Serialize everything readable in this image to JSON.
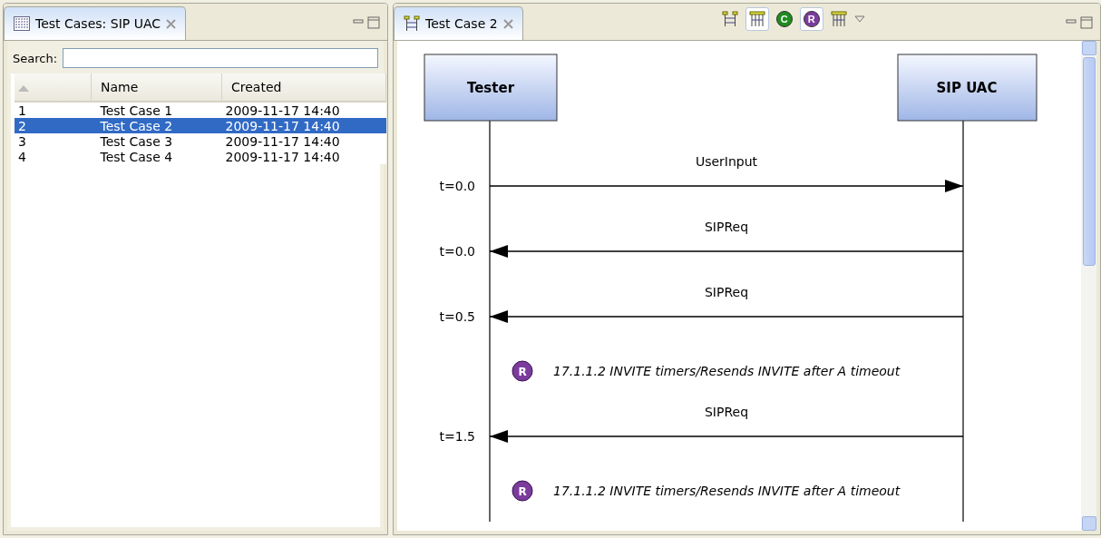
{
  "left_panel": {
    "tab": {
      "title": "Test Cases: SIP UAC",
      "selected": true
    },
    "search": {
      "label": "Search:"
    },
    "table": {
      "columns": [
        "Name",
        "Created"
      ],
      "rows": [
        {
          "index": "1",
          "name": "Test Case 1",
          "created": "2009-11-17 14:40",
          "selected": false
        },
        {
          "index": "2",
          "name": "Test Case 2",
          "created": "2009-11-17 14:40",
          "selected": true
        },
        {
          "index": "3",
          "name": "Test Case 3",
          "created": "2009-11-17 14:40",
          "selected": false
        },
        {
          "index": "4",
          "name": "Test Case 4",
          "created": "2009-11-17 14:40",
          "selected": false
        }
      ]
    }
  },
  "editor": {
    "tab": {
      "title": "Test Case 2",
      "selected": true
    },
    "toolbar": [
      {
        "kind": "layout",
        "pressed": false
      },
      {
        "kind": "grid",
        "pressed": true
      },
      {
        "kind": "badge",
        "letter": "C",
        "color": "#1e8c1e",
        "pressed": false
      },
      {
        "kind": "badge",
        "letter": "R",
        "color": "#7b3c9c",
        "pressed": true
      },
      {
        "kind": "grid",
        "pressed": false
      }
    ],
    "diagram": {
      "lifelines": [
        "Tester",
        "SIP UAC"
      ],
      "events": [
        {
          "kind": "message_right",
          "label": "UserInput",
          "time": "t=0.0"
        },
        {
          "kind": "message_left",
          "label": "SIPReq",
          "time": "t=0.0"
        },
        {
          "kind": "message_left",
          "label": "SIPReq",
          "time": "t=0.5"
        },
        {
          "kind": "requirement",
          "letter": "R",
          "text": "17.1.1.2 INVITE timers/Resends INVITE after A timeout"
        },
        {
          "kind": "message_left",
          "label": "SIPReq",
          "time": "t=1.5"
        },
        {
          "kind": "requirement",
          "letter": "R",
          "text": "17.1.1.2 INVITE timers/Resends INVITE after A timeout"
        }
      ]
    }
  }
}
